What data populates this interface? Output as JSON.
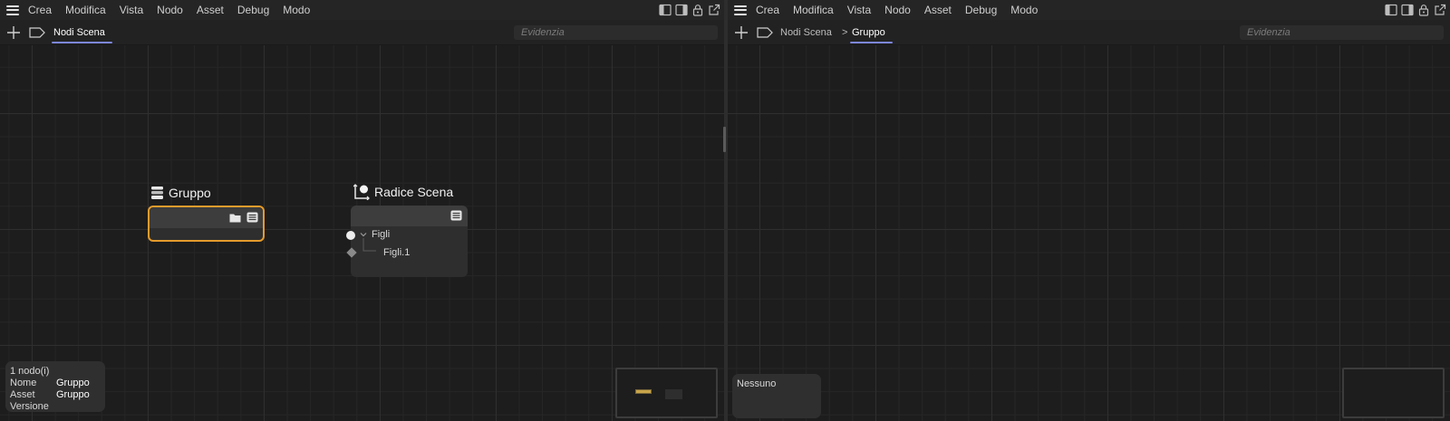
{
  "menu": [
    "Crea",
    "Modifica",
    "Vista",
    "Nodo",
    "Asset",
    "Debug",
    "Modo"
  ],
  "icons": {
    "menu": "hamburger-icon",
    "layout_left": "sidebar-left-icon",
    "layout_right": "sidebar-right-icon",
    "lock": "lock-icon",
    "popout": "popout-icon",
    "add": "plus-icon",
    "tag": "tag-icon"
  },
  "colors": {
    "accent_underline": "#7d86d8",
    "selection": "#e49b2c",
    "panel_bg": "#1e1e1e"
  },
  "left": {
    "breadcrumb": [
      "Nodi Scena"
    ],
    "search_placeholder": "Evidenzia",
    "nodes": {
      "group": {
        "title": "Gruppo",
        "selected": true
      },
      "root": {
        "title": "Radice Scena",
        "ports": [
          "Figli",
          "Figli.1"
        ]
      }
    },
    "info": {
      "count": "1 nodo(i)",
      "rows": [
        {
          "key": "Nome",
          "value": "Gruppo"
        },
        {
          "key": "Asset",
          "value": "Gruppo"
        },
        {
          "key": "Versione",
          "value": ""
        }
      ]
    }
  },
  "right": {
    "breadcrumb": [
      "Nodi Scena",
      "Gruppo"
    ],
    "breadcrumb_separator": ">",
    "search_placeholder": "Evidenzia",
    "info": {
      "text": "Nessuno"
    }
  }
}
